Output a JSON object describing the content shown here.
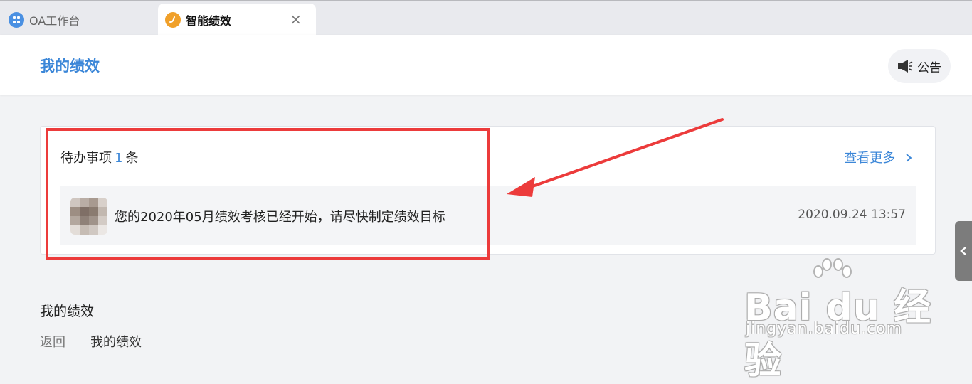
{
  "tabs": [
    {
      "label": "OA工作台",
      "icon": "app-grid-icon"
    },
    {
      "label": "智能绩效",
      "icon": "performance-app-icon",
      "close_glyph": "×"
    }
  ],
  "header": {
    "title": "我的绩效",
    "notice_label": "公告",
    "notice_icon": "megaphone-icon"
  },
  "todo": {
    "title": "待办事项",
    "count": "1",
    "unit": "条",
    "more_label": "查看更多",
    "more_icon": "chevron-right-icon",
    "items": [
      {
        "text": "您的2020年05月绩效考核已经开始，请尽快制定绩效目标",
        "time": "2020.09.24 13:57"
      }
    ]
  },
  "section": {
    "title": "我的绩效",
    "breadcrumb": [
      "返回",
      "我的绩效"
    ]
  },
  "watermark": {
    "main": "Bai du 经验",
    "sub": "jingyan.baidu.com"
  },
  "colors": {
    "accent": "#3c87d8",
    "highlight": "#ec3b3b",
    "background": "#f2f3f5"
  }
}
